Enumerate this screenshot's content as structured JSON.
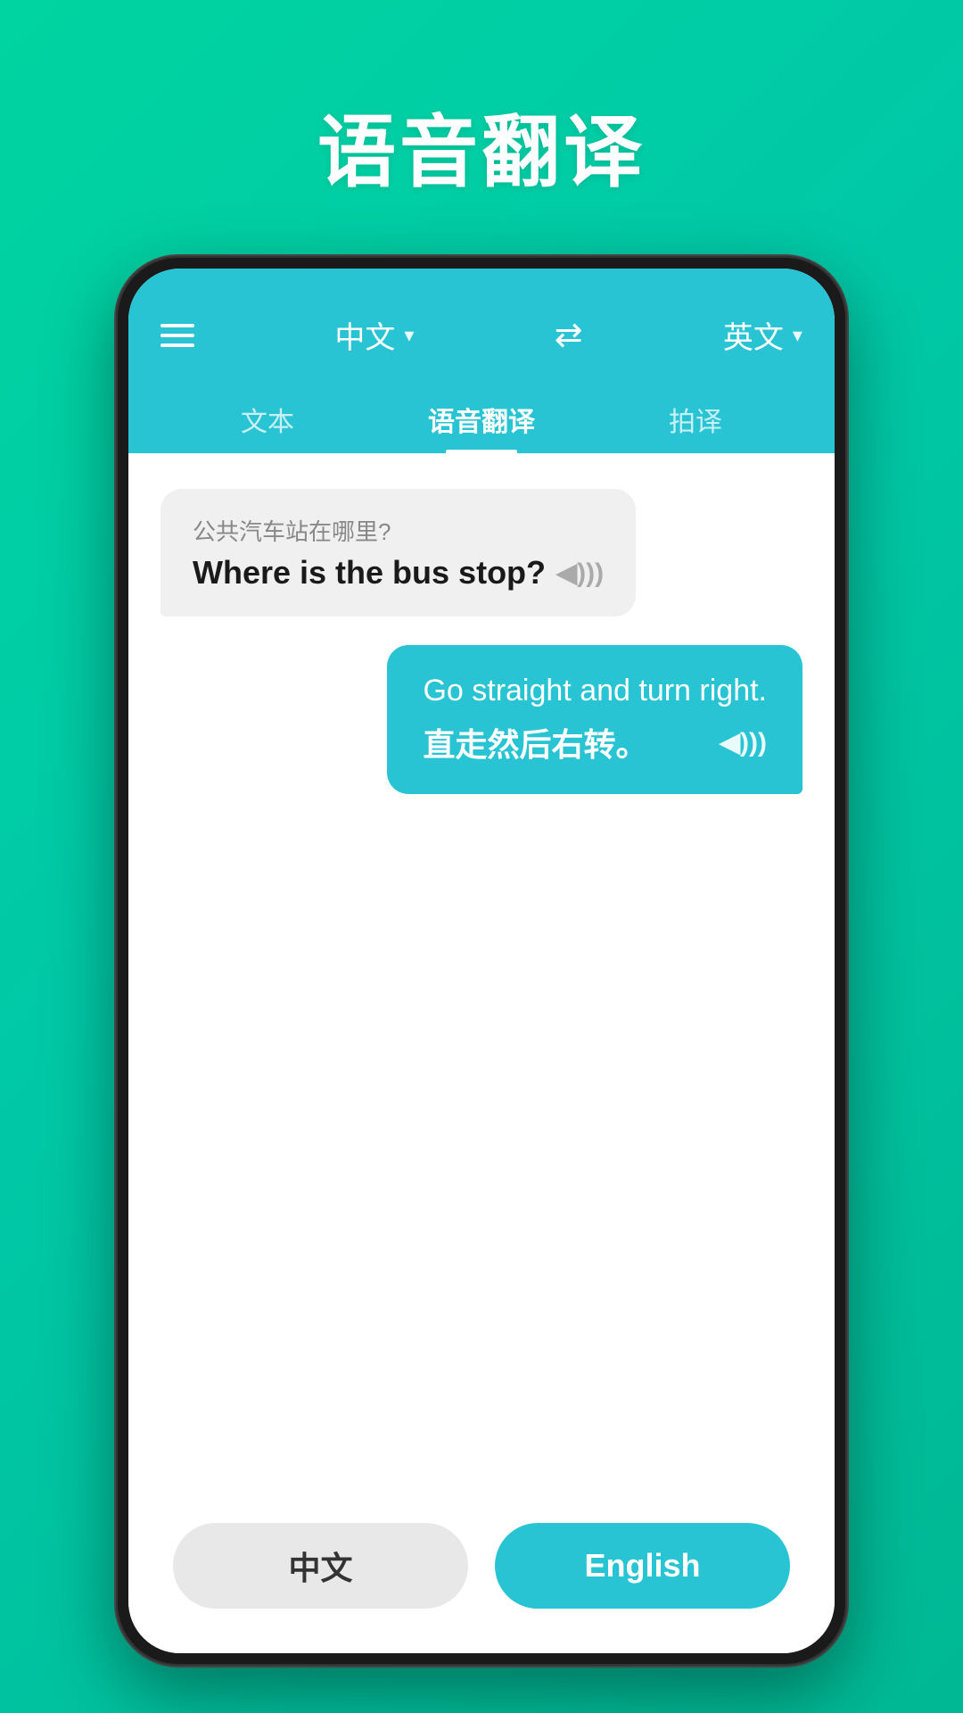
{
  "page": {
    "title": "语音翻译",
    "background_gradient_start": "#00d4a0",
    "background_gradient_end": "#00b894"
  },
  "header": {
    "source_lang": "中文",
    "source_lang_chevron": "▾",
    "target_lang": "英文",
    "target_lang_chevron": "▾",
    "swap_icon": "⇄",
    "accent_color": "#29c4d4"
  },
  "tabs": [
    {
      "label": "文本",
      "active": false
    },
    {
      "label": "语音翻译",
      "active": true
    },
    {
      "label": "拍译",
      "active": false
    }
  ],
  "messages": [
    {
      "side": "left",
      "sub_text": "公共汽车站在哪里?",
      "main_text": "Where is the bus stop?",
      "sound_icon": "◀)))"
    },
    {
      "side": "right",
      "main_text": "Go straight and turn right.",
      "sub_text": "直走然后右转。",
      "sound_icon": "◀)))"
    }
  ],
  "bottom_bar": {
    "chinese_btn_label": "中文",
    "english_btn_label": "English"
  }
}
